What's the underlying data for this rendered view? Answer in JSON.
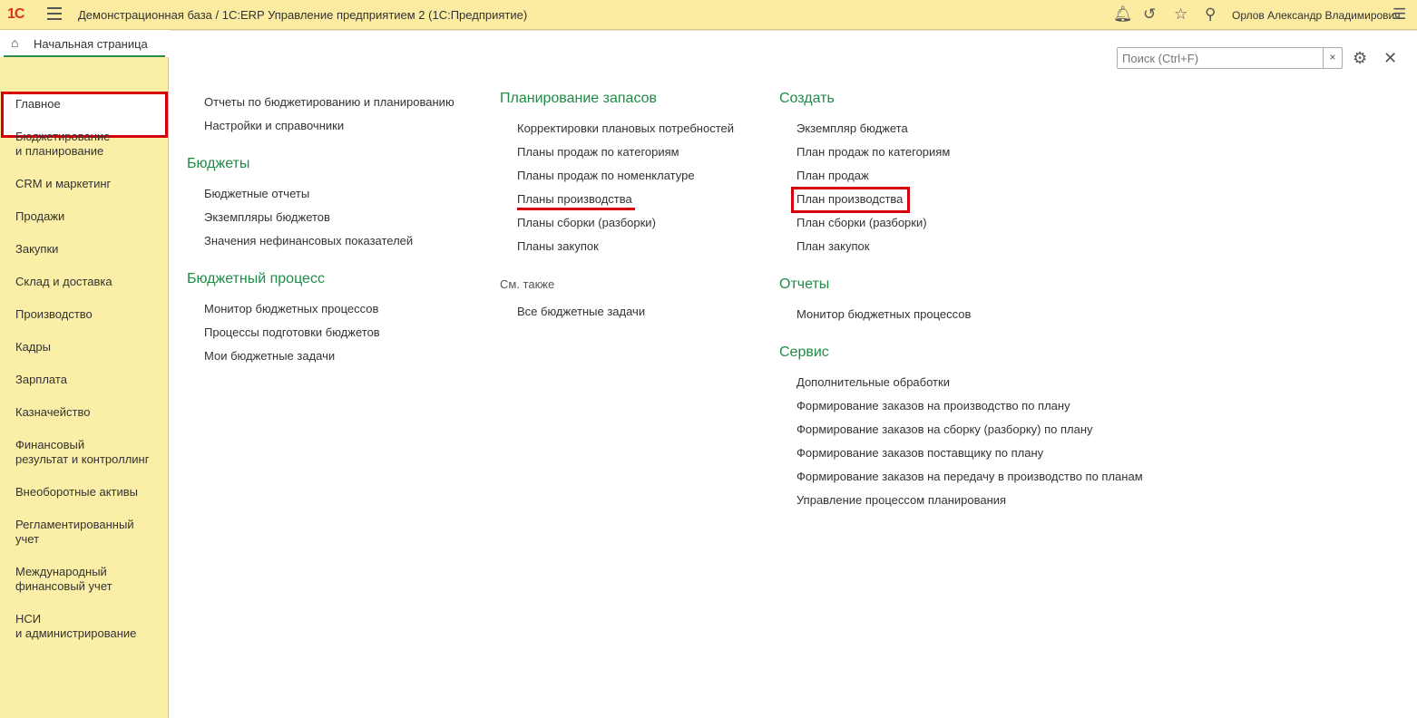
{
  "header": {
    "logo": "1С",
    "title": "Демонстрационная база / 1С:ERP Управление предприятием 2  (1С:Предприятие)",
    "user": "Орлов Александр Владимирович"
  },
  "sidebar": {
    "home": "Начальная страница",
    "items": [
      {
        "label": "Главное",
        "top": "1"
      },
      {
        "label": "Бюджетирование\nи планирование"
      },
      {
        "label": "CRM и маркетинг"
      },
      {
        "label": "Продажи"
      },
      {
        "label": "Закупки"
      },
      {
        "label": "Склад и доставка"
      },
      {
        "label": "Производство"
      },
      {
        "label": "Кадры"
      },
      {
        "label": "Зарплата"
      },
      {
        "label": "Казначейство"
      },
      {
        "label": "Финансовый\nрезультат и контроллинг"
      },
      {
        "label": "Внеоборотные активы"
      },
      {
        "label": "Регламентированный\nучет"
      },
      {
        "label": "Международный\nфинансовый учет"
      },
      {
        "label": "НСИ\nи администрирование"
      }
    ]
  },
  "search": {
    "placeholder": "Поиск (Ctrl+F)",
    "clear": "×"
  },
  "columns": [
    {
      "blocks": [
        {
          "heading": null,
          "items": [
            "Отчеты по бюджетированию и планированию",
            "Настройки и справочники"
          ]
        },
        {
          "heading": "Бюджеты",
          "items": [
            "Бюджетные отчеты",
            "Экземпляры бюджетов",
            "Значения нефинансовых показателей"
          ]
        },
        {
          "heading": "Бюджетный процесс",
          "items": [
            "Монитор бюджетных процессов",
            "Процессы подготовки бюджетов",
            "Мои бюджетные задачи"
          ]
        }
      ]
    },
    {
      "blocks": [
        {
          "heading": "Планирование запасов",
          "items": [
            "Корректировки плановых потребностей",
            "Планы продаж по категориям",
            "Планы продаж по номенклатуре",
            "Планы производства",
            "Планы сборки (разборки)",
            "Планы закупок"
          ]
        },
        {
          "subheading": "См. также",
          "items": [
            "Все бюджетные задачи"
          ]
        }
      ]
    },
    {
      "blocks": [
        {
          "heading": "Создать",
          "items": [
            "Экземпляр бюджета",
            "План продаж по категориям",
            "План продаж",
            "План производства",
            "План сборки (разборки)",
            "План закупок"
          ]
        },
        {
          "heading": "Отчеты",
          "items": [
            "Монитор бюджетных процессов"
          ]
        },
        {
          "heading": "Сервис",
          "items": [
            "Дополнительные обработки",
            "Формирование заказов на производство по плану",
            "Формирование заказов на сборку (разборку) по плану",
            "Формирование заказов поставщику по плану",
            "Формирование заказов на передачу в производство по планам",
            "Управление процессом планирования"
          ]
        }
      ]
    }
  ]
}
